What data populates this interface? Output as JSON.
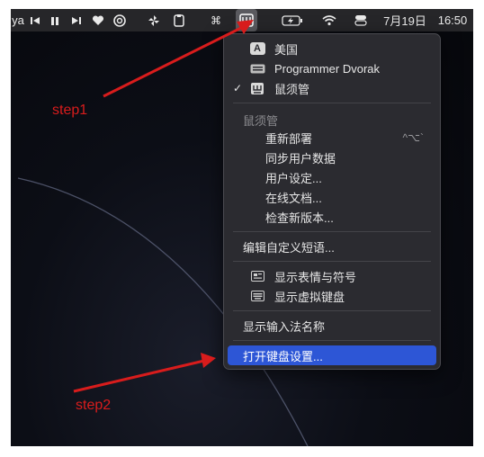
{
  "menubar": {
    "leading_text": "ya",
    "date": "7月19日",
    "time": "16:50"
  },
  "input_menu": {
    "sources": [
      {
        "label": "美国",
        "icon": "letter-a-icon",
        "glyph": "A",
        "checked": false
      },
      {
        "label": "Programmer Dvorak",
        "icon": "keyboard-icon",
        "checked": false
      },
      {
        "label": "鼠须管",
        "icon": "squirrel-input-icon",
        "checked": true,
        "check_mark": "✓"
      }
    ],
    "section_title": "鼠须管",
    "app_items": [
      {
        "label": "重新部署",
        "shortcut": "^⌥`"
      },
      {
        "label": "同步用户数据"
      },
      {
        "label": "用户设定..."
      },
      {
        "label": "在线文档..."
      },
      {
        "label": "检查新版本..."
      }
    ],
    "edit_shortcuts": "编辑自定义短语...",
    "show_emoji": "显示表情与符号",
    "show_virtual_keyboard": "显示虚拟键盘",
    "show_input_name": "显示输入法名称",
    "open_keyboard_settings": "打开键盘设置..."
  },
  "annotations": {
    "step1": "step1",
    "step2": "step2",
    "color": "#d81c1c"
  },
  "colors": {
    "highlight": "#2d56d6",
    "menu_bg": "#2b2b30",
    "menubar_bg": "#262629"
  }
}
